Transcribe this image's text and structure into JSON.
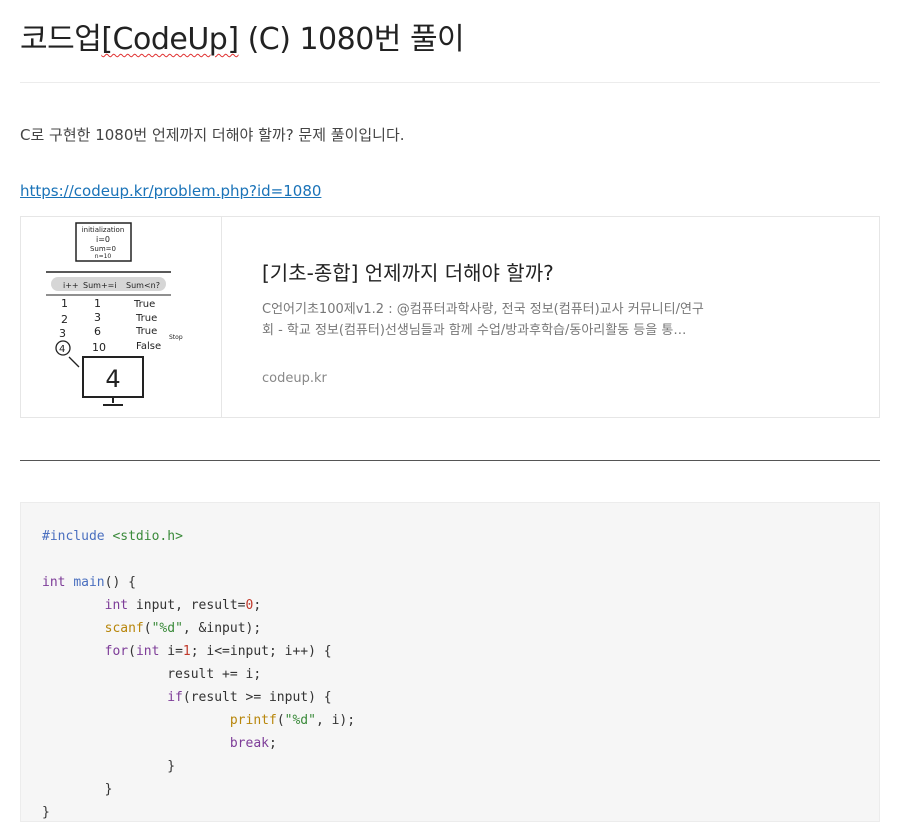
{
  "post": {
    "title_part1": "코드업",
    "title_part2": "[CodeUp]",
    "title_part3": " (C) 1080번 풀이",
    "intro": "C로 구현한 1080번 언제까지 더해야 할까? 문제 풀이입니다.",
    "link": "https://codeup.kr/problem.php?id=1080"
  },
  "card": {
    "title": "[기초-종합] 언제까지 더해야 할까?",
    "desc_line1": "C언어기초100제v1.2 : @컴퓨터과학사랑, 전국 정보(컴퓨터)교사 커뮤니티/연구",
    "desc_line2": "회 - 학교 정보(컴퓨터)선생님들과 함께 수업/방과후학습/동아리활동 등을 통…",
    "domain": "codeup.kr",
    "thumb": {
      "init_label": "initialization",
      "init_i": "i=0",
      "init_sum": "Sum=0",
      "init_n": "n=10",
      "col1": "i++",
      "col2": "Sum+=i",
      "col3": "Sum<n?",
      "r1": [
        "1",
        "1",
        "True"
      ],
      "r2": [
        "2",
        "3",
        "True"
      ],
      "r3": [
        "3",
        "6",
        "True"
      ],
      "r4": [
        "4",
        "10",
        "False"
      ],
      "stop": "Stop",
      "result": "4"
    }
  },
  "code": {
    "include_directive": "#include",
    "include_file": "<stdio.h>",
    "int_kw": "int",
    "main_fn": "main",
    "main_rest": "() {",
    "decl_kw": "int",
    "decl_a": " input, result=",
    "decl_num": "0",
    "decl_b": ";",
    "scanf_fn": "scanf",
    "scanf_open": "(",
    "scanf_str": "\"%d\"",
    "scanf_rest": ", &input);",
    "for_kw": "for",
    "for_open": "(",
    "for_int": "int",
    "for_a": " i=",
    "for_num": "1",
    "for_b": "; i<=input; i++) {",
    "add_line": "result += i;",
    "if_kw": "if",
    "if_rest": "(result >= input) {",
    "printf_fn": "printf",
    "printf_open": "(",
    "printf_str": "\"%d\"",
    "printf_rest": ", i);",
    "break_kw": "break",
    "break_semi": ";",
    "close1": "}",
    "close2": "}",
    "close3": "}"
  }
}
